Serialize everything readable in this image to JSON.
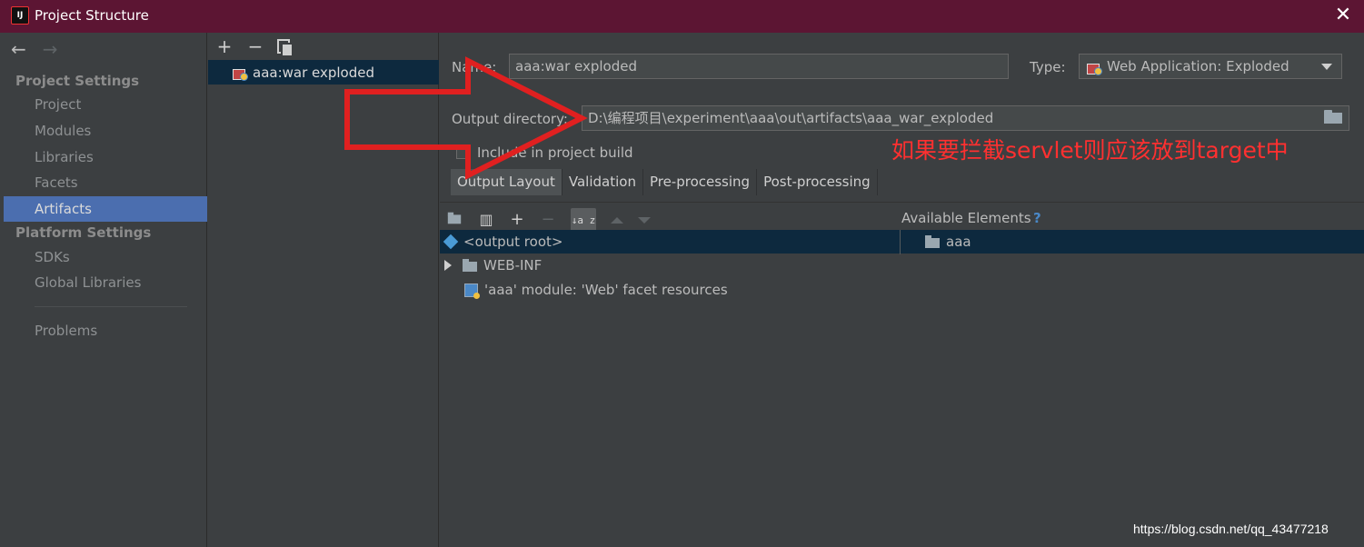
{
  "window": {
    "title": "Project Structure",
    "close": "✕",
    "app_icon_text": "IJ"
  },
  "nav": {
    "back": "←",
    "forward": "→",
    "project_settings_header": "Project Settings",
    "platform_settings_header": "Platform Settings",
    "items": [
      {
        "label": "Project"
      },
      {
        "label": "Modules"
      },
      {
        "label": "Libraries"
      },
      {
        "label": "Facets"
      },
      {
        "label": "Artifacts",
        "selected": true
      },
      {
        "label": "SDKs"
      },
      {
        "label": "Global Libraries"
      },
      {
        "label": "Problems"
      }
    ]
  },
  "artifacts_panel": {
    "add": "+",
    "remove": "−",
    "selected_artifact": "aaa:war exploded"
  },
  "details": {
    "name_label": "Name:",
    "name_value": "aaa:war exploded",
    "type_label": "Type:",
    "type_value": "Web Application: Exploded",
    "output_dir_label": "Output directory:",
    "output_dir_value": "D:\\编程项目\\experiment\\aaa\\out\\artifacts\\aaa_war_exploded",
    "include_build_label": "Include in project build",
    "include_build_checked": false
  },
  "annotation": "如果要拦截servlet则应该放到target中",
  "annotation_color": "#ff3030",
  "tabs": [
    {
      "label": "Output Layout",
      "selected": true
    },
    {
      "label": "Validation"
    },
    {
      "label": "Pre-processing"
    },
    {
      "label": "Post-processing"
    }
  ],
  "layout": {
    "add": "+",
    "remove": "−",
    "sort_label": "↓a z",
    "available_elements_label": "Available Elements",
    "help": "?",
    "tree": [
      {
        "label": "<output root>",
        "icon": "output-root-icon",
        "selected": true
      },
      {
        "label": "WEB-INF",
        "icon": "folder-icon",
        "expandable": true
      },
      {
        "label": "'aaa' module: 'Web' facet resources",
        "icon": "web-facet-icon"
      }
    ],
    "available": [
      {
        "label": "aaa",
        "icon": "module-folder-icon"
      }
    ]
  },
  "watermark": "https://blog.csdn.net/qq_43477218",
  "colors": {
    "titlebar": "#5c1533",
    "selection": "#4b6eaf",
    "tree_selection": "#0d293e",
    "arrow": "#e02020"
  }
}
